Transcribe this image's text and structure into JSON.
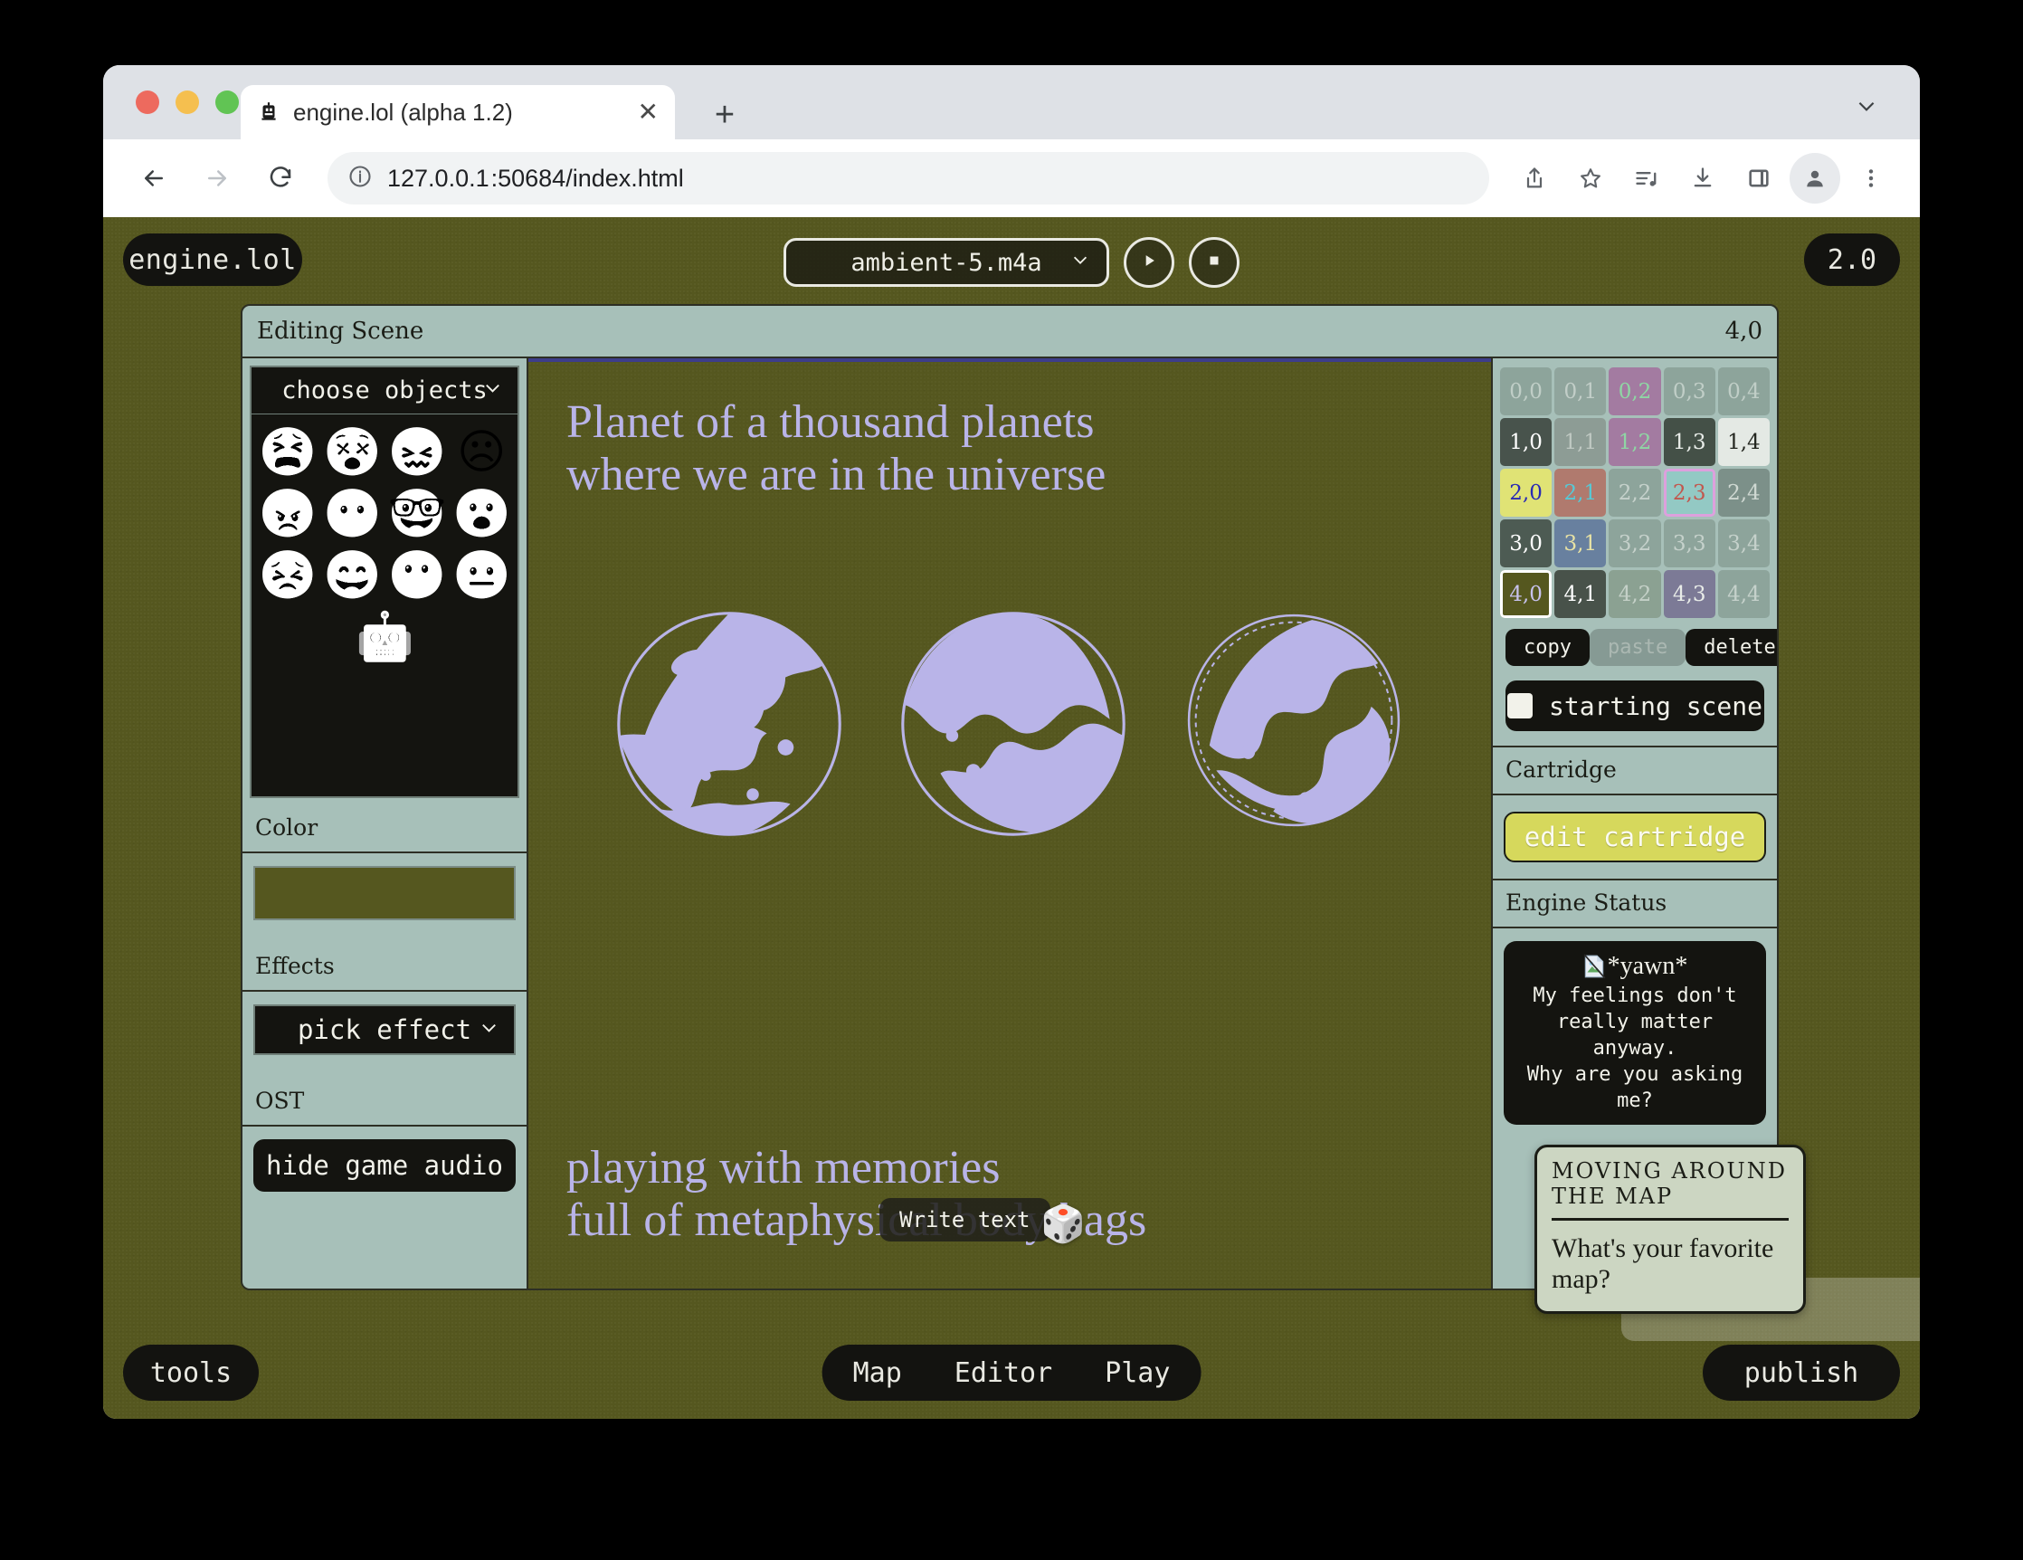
{
  "browser": {
    "tab": {
      "title": "engine.lol (alpha 1.2)",
      "favicon_icon": "robot-face-icon",
      "close_icon": "close-icon"
    },
    "new_tab_icon": "plus-icon",
    "tabstrip_chevron_icon": "chevron-down-icon",
    "back_icon": "arrow-left-icon",
    "forward_icon": "arrow-right-icon",
    "reload_icon": "reload-icon",
    "url": {
      "info_icon": "info-circle-icon",
      "host": "127.0.0.1",
      "rest": ":50684/index.html"
    },
    "toolbar_icons": [
      "share-icon",
      "star-icon",
      "media-playlist-icon",
      "download-icon",
      "side-panel-icon",
      "profile-avatar-icon",
      "kebab-menu-icon"
    ]
  },
  "app": {
    "brand": "engine.lol",
    "version": "2.0",
    "audio": {
      "track": "ambient-5.m4a",
      "chevron_icon": "chevron-down-icon",
      "play_icon": "play-icon",
      "stop_icon": "stop-icon"
    },
    "editor": {
      "header_label": "Editing Scene",
      "header_coord": "4,0"
    },
    "left_panel": {
      "object_select": {
        "label": "choose objects",
        "chevron_icon": "chevron-down-icon"
      },
      "sprites": [
        "😫",
        "😵",
        "😖",
        "☹",
        "😠",
        "😶",
        "🤓",
        "😮",
        "😣",
        "😄",
        "😬",
        "😐",
        "🤖"
      ],
      "color_label": "Color",
      "color_value": "#55571f",
      "effects_label": "Effects",
      "effect_select": {
        "label": "pick effect",
        "chevron_icon": "chevron-down-icon"
      },
      "ost_label": "OST",
      "hide_audio_button": "hide game audio"
    },
    "canvas": {
      "text_top": "Planet of a thousand planets\nwhere we are in the universe",
      "text_bottom": "playing with memories\nfull of metaphysical body bags",
      "text_color": "#b9b4e8",
      "planet_color": "#b9b4e8",
      "planet_count": 3,
      "tooltip": "Write text",
      "cursor_icon": "die-cursor-icon"
    },
    "right_panel": {
      "grid": [
        [
          {
            "label": "0,0",
            "bg": "rgba(120,140,132,0.55)",
            "fg": "rgba(235,240,235,0.55)"
          },
          {
            "label": "0,1",
            "bg": "rgba(125,142,135,0.55)",
            "fg": "rgba(235,240,235,0.55)"
          },
          {
            "label": "0,2",
            "bg": "rgba(162,110,156,0.85)",
            "fg": "#8fd6a4"
          },
          {
            "label": "0,3",
            "bg": "rgba(120,140,132,0.55)",
            "fg": "rgba(235,240,235,0.55)"
          },
          {
            "label": "0,4",
            "bg": "rgba(120,140,132,0.55)",
            "fg": "rgba(235,240,235,0.55)"
          }
        ],
        [
          {
            "label": "1,0",
            "bg": "rgba(66,77,70,0.95)",
            "fg": "#ffffff"
          },
          {
            "label": "1,1",
            "bg": "rgba(135,146,140,0.8)",
            "fg": "rgba(225,230,225,0.6)"
          },
          {
            "label": "1,2",
            "bg": "rgba(162,110,156,0.85)",
            "fg": "#8fd6a4"
          },
          {
            "label": "1,3",
            "bg": "rgba(62,74,64,0.95)",
            "fg": "#e8ece8"
          },
          {
            "label": "1,4",
            "bg": "#e4e9e4",
            "fg": "#23261f"
          }
        ],
        [
          {
            "label": "2,0",
            "bg": "#e0e375",
            "fg": "#2a2ab4"
          },
          {
            "label": "2,1",
            "bg": "#b07a6e",
            "fg": "#56c9d6"
          },
          {
            "label": "2,2",
            "bg": "rgba(120,140,132,0.55)",
            "fg": "rgba(235,240,235,0.6)"
          },
          {
            "label": "2,3",
            "bg": "#93c9c4",
            "fg": "#c2574e",
            "sel": "pink"
          },
          {
            "label": "2,4",
            "bg": "rgba(110,128,121,0.75)",
            "fg": "rgba(235,240,235,0.75)"
          }
        ],
        [
          {
            "label": "3,0",
            "bg": "rgba(68,80,72,0.9)",
            "fg": "#ffffff"
          },
          {
            "label": "3,1",
            "bg": "#68809f",
            "fg": "#e8e2a4"
          },
          {
            "label": "3,2",
            "bg": "rgba(120,140,132,0.55)",
            "fg": "rgba(235,240,235,0.6)"
          },
          {
            "label": "3,3",
            "bg": "rgba(120,140,132,0.55)",
            "fg": "rgba(235,240,235,0.6)"
          },
          {
            "label": "3,4",
            "bg": "rgba(120,140,132,0.55)",
            "fg": "rgba(235,240,235,0.6)"
          }
        ],
        [
          {
            "label": "4,0",
            "bg": "#55571f",
            "fg": "#c8c2ee",
            "sel": "white"
          },
          {
            "label": "4,1",
            "bg": "rgba(62,70,62,0.9)",
            "fg": "#ffffff"
          },
          {
            "label": "4,2",
            "bg": "rgba(120,140,120,0.6)",
            "fg": "rgba(235,240,235,0.6)"
          },
          {
            "label": "4,3",
            "bg": "#7c7a96",
            "fg": "#e8ece8"
          },
          {
            "label": "4,4",
            "bg": "rgba(120,140,132,0.55)",
            "fg": "rgba(235,240,235,0.6)"
          }
        ]
      ],
      "buttons": {
        "copy": "copy",
        "paste": "paste",
        "delete": "delete"
      },
      "starting_scene": {
        "label": "starting scene",
        "checked": false
      },
      "cartridge_label": "Cartridge",
      "edit_cartridge_button": "edit cartridge",
      "engine_status_label": "Engine Status",
      "status": {
        "broken_image_icon": "broken-image-icon",
        "title": "*yawn*",
        "body": "My feelings don't\nreally matter anyway.\nWhy are you asking me?"
      }
    },
    "bottom_bar": {
      "tools": "tools",
      "nav": [
        "Map",
        "Editor",
        "Play"
      ],
      "publish": "publish"
    },
    "map_popup": {
      "title": "MOVING AROUND THE MAP",
      "body": "What's your favorite map?"
    }
  }
}
